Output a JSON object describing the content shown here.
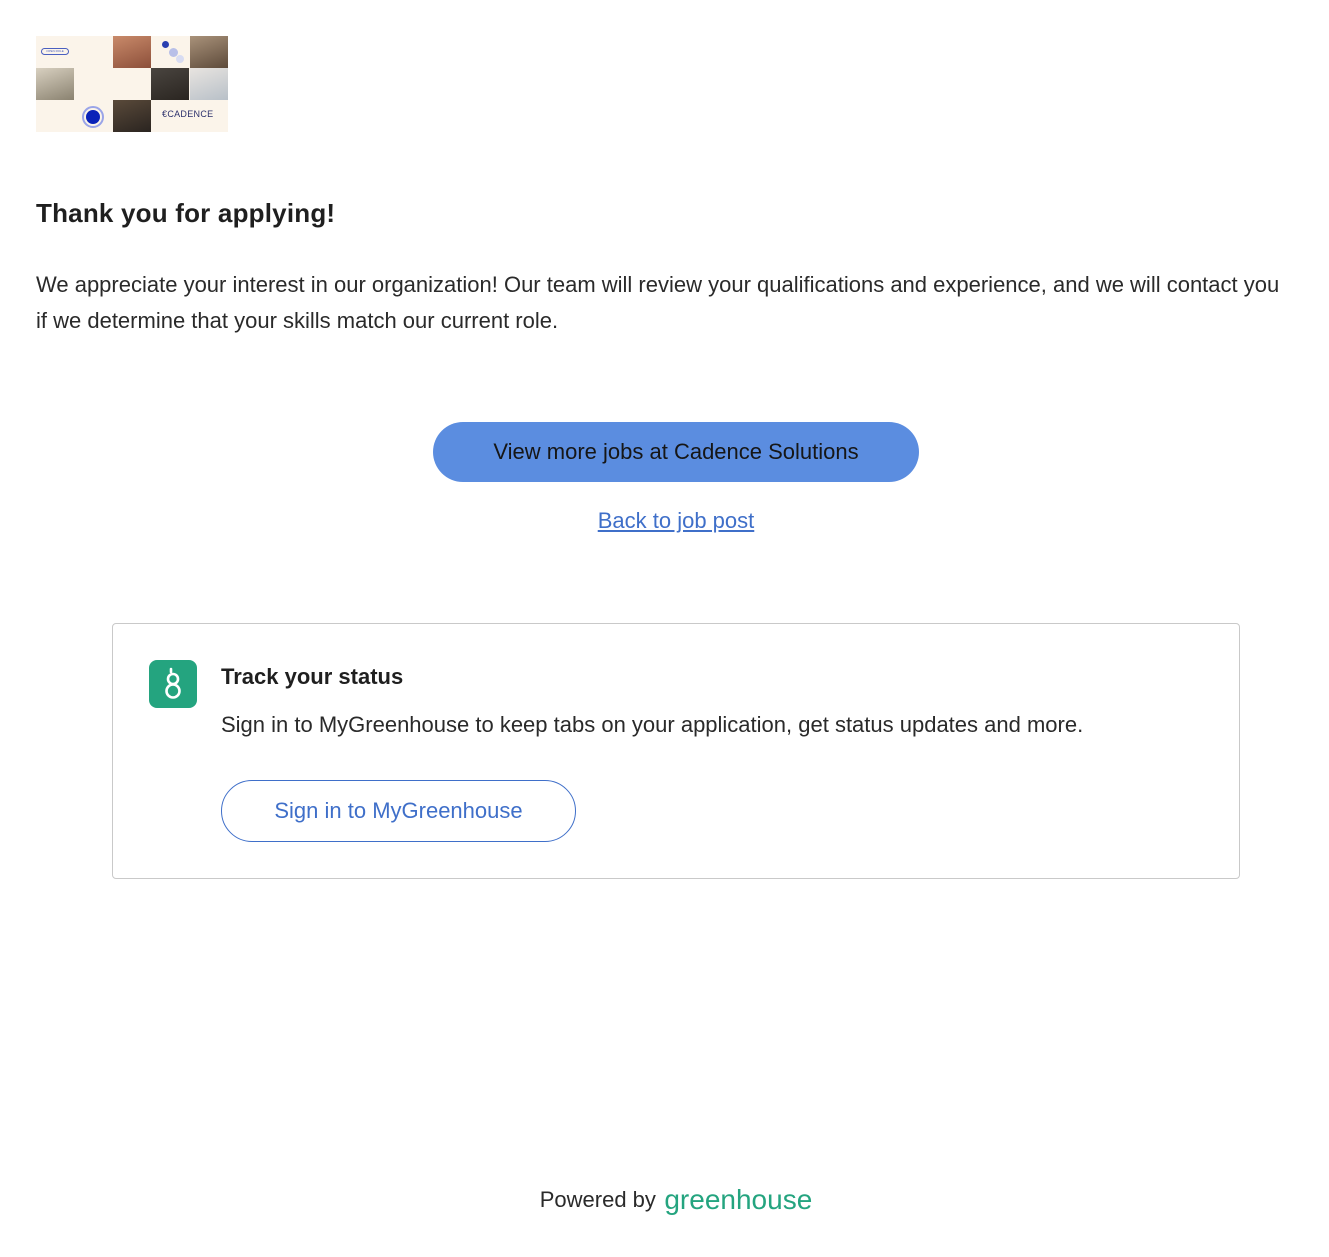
{
  "company_logo": {
    "badge_text": "OPEN ROLE",
    "brand_text": "CADENCE"
  },
  "confirmation": {
    "title": "Thank you for applying!",
    "message": "We appreciate your interest in our organization! Our team will review your qualifications and experience, and we will contact you if we determine that your skills match our current role."
  },
  "actions": {
    "view_more_jobs": "View more jobs at Cadence Solutions",
    "back_to_job_post": "Back to job post"
  },
  "track_status": {
    "icon": "greenhouse-g-icon",
    "title": "Track your status",
    "description": "Sign in to MyGreenhouse to keep tabs on your application, get status updates and more.",
    "sign_in_label": "Sign in to MyGreenhouse"
  },
  "footer": {
    "powered_by": "Powered by",
    "brand": "greenhouse"
  },
  "colors": {
    "primary_button": "#5b8de0",
    "link": "#3f6fc9",
    "greenhouse_green": "#24a47f"
  }
}
